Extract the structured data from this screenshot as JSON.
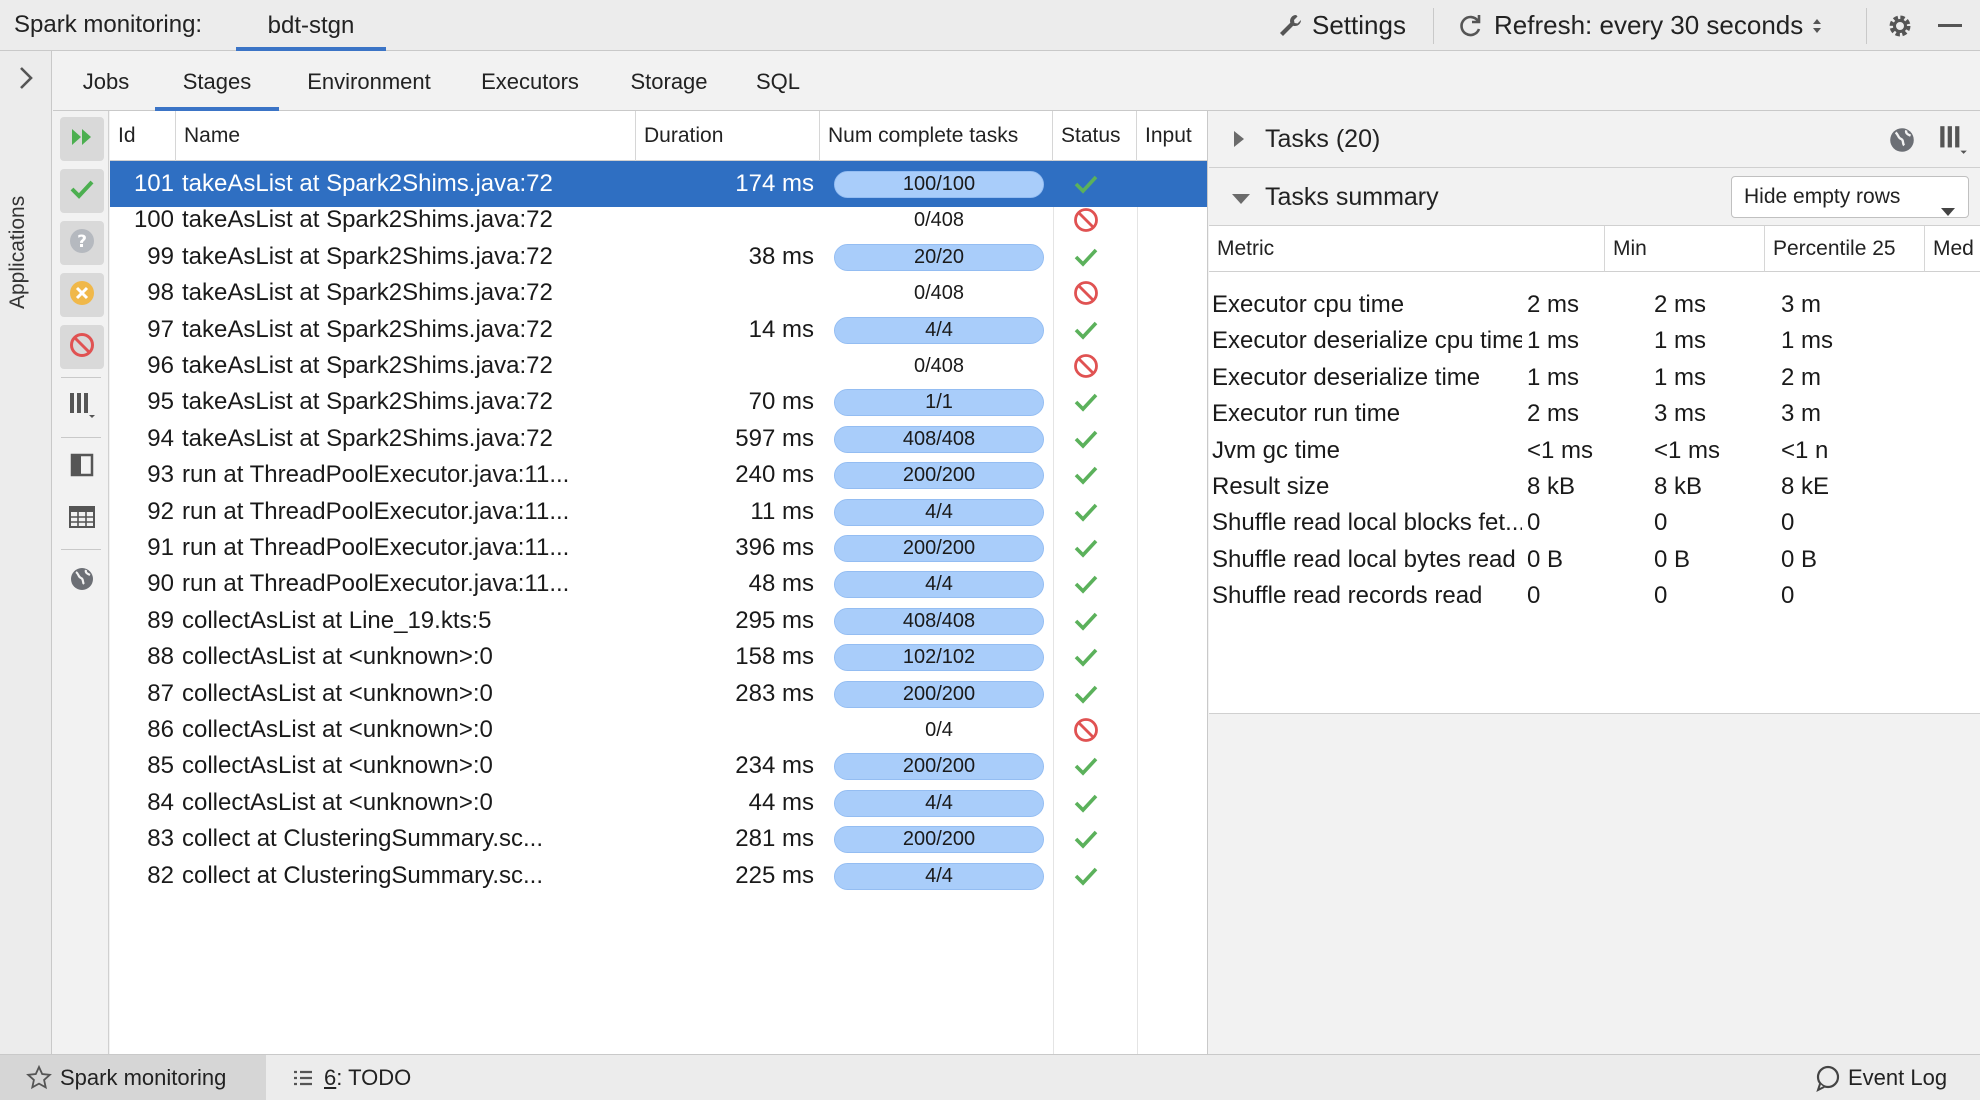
{
  "topbar": {
    "label": "Spark monitoring:",
    "project_tab": "bdt-stgn",
    "settings": "Settings",
    "refresh": "Refresh: every 30 seconds"
  },
  "left_strip": {
    "label": "Applications"
  },
  "tabs": [
    {
      "label": "Jobs"
    },
    {
      "label": "Stages",
      "active": true
    },
    {
      "label": "Environment"
    },
    {
      "label": "Executors"
    },
    {
      "label": "Storage"
    },
    {
      "label": "SQL"
    }
  ],
  "stages": {
    "columns": [
      "Id",
      "Name",
      "Duration",
      "Num complete tasks",
      "Status",
      "Input"
    ],
    "rows": [
      {
        "id": "101",
        "name": "takeAsList at Spark2Shims.java:72",
        "duration": "174 ms",
        "tasks": "100/100",
        "progress": 1,
        "status": "succeeded",
        "selected": true
      },
      {
        "id": "100",
        "name": "takeAsList at Spark2Shims.java:72",
        "duration": "",
        "tasks": "0/408",
        "progress": 0,
        "status": "failed"
      },
      {
        "id": "99",
        "name": "takeAsList at Spark2Shims.java:72",
        "duration": "38 ms",
        "tasks": "20/20",
        "progress": 1,
        "status": "succeeded"
      },
      {
        "id": "98",
        "name": "takeAsList at Spark2Shims.java:72",
        "duration": "",
        "tasks": "0/408",
        "progress": 0,
        "status": "failed"
      },
      {
        "id": "97",
        "name": "takeAsList at Spark2Shims.java:72",
        "duration": "14 ms",
        "tasks": "4/4",
        "progress": 1,
        "status": "succeeded"
      },
      {
        "id": "96",
        "name": "takeAsList at Spark2Shims.java:72",
        "duration": "",
        "tasks": "0/408",
        "progress": 0,
        "status": "failed"
      },
      {
        "id": "95",
        "name": "takeAsList at Spark2Shims.java:72",
        "duration": "70 ms",
        "tasks": "1/1",
        "progress": 1,
        "status": "succeeded"
      },
      {
        "id": "94",
        "name": "takeAsList at Spark2Shims.java:72",
        "duration": "597 ms",
        "tasks": "408/408",
        "progress": 1,
        "status": "succeeded"
      },
      {
        "id": "93",
        "name": "run at ThreadPoolExecutor.java:11...",
        "duration": "240 ms",
        "tasks": "200/200",
        "progress": 1,
        "status": "succeeded"
      },
      {
        "id": "92",
        "name": "run at ThreadPoolExecutor.java:11...",
        "duration": "11 ms",
        "tasks": "4/4",
        "progress": 1,
        "status": "succeeded"
      },
      {
        "id": "91",
        "name": "run at ThreadPoolExecutor.java:11...",
        "duration": "396 ms",
        "tasks": "200/200",
        "progress": 1,
        "status": "succeeded"
      },
      {
        "id": "90",
        "name": "run at ThreadPoolExecutor.java:11...",
        "duration": "48 ms",
        "tasks": "4/4",
        "progress": 1,
        "status": "succeeded"
      },
      {
        "id": "89",
        "name": "collectAsList at Line_19.kts:5",
        "duration": "295 ms",
        "tasks": "408/408",
        "progress": 1,
        "status": "succeeded"
      },
      {
        "id": "88",
        "name": "collectAsList at <unknown>:0",
        "duration": "158 ms",
        "tasks": "102/102",
        "progress": 1,
        "status": "succeeded"
      },
      {
        "id": "87",
        "name": "collectAsList at <unknown>:0",
        "duration": "283 ms",
        "tasks": "200/200",
        "progress": 1,
        "status": "succeeded"
      },
      {
        "id": "86",
        "name": "collectAsList at <unknown>:0",
        "duration": "",
        "tasks": "0/4",
        "progress": 0,
        "status": "failed"
      },
      {
        "id": "85",
        "name": "collectAsList at <unknown>:0",
        "duration": "234 ms",
        "tasks": "200/200",
        "progress": 1,
        "status": "succeeded"
      },
      {
        "id": "84",
        "name": "collectAsList at <unknown>:0",
        "duration": "44 ms",
        "tasks": "4/4",
        "progress": 1,
        "status": "succeeded"
      },
      {
        "id": "83",
        "name": "collect at ClusteringSummary.sc...",
        "duration": "281 ms",
        "tasks": "200/200",
        "progress": 1,
        "status": "succeeded"
      },
      {
        "id": "82",
        "name": "collect at ClusteringSummary.sc...",
        "duration": "225 ms",
        "tasks": "4/4",
        "progress": 1,
        "status": "succeeded"
      }
    ]
  },
  "right_panel": {
    "tasks_title": "Tasks (20)",
    "summary_title": "Tasks summary",
    "filter_value": "Hide empty rows",
    "metric_columns": [
      "Metric",
      "Min",
      "Percentile 25",
      "Med"
    ],
    "metrics": [
      [
        "Executor cpu time",
        "2 ms",
        "2 ms",
        "3 m"
      ],
      [
        "Executor deserialize cpu time",
        "1 ms",
        "1 ms",
        "1 ms"
      ],
      [
        "Executor deserialize time",
        "1 ms",
        "1 ms",
        "2 m"
      ],
      [
        "Executor run time",
        "2 ms",
        "3 ms",
        "3 m"
      ],
      [
        "Jvm gc time",
        "<1 ms",
        "<1 ms",
        "<1 n"
      ],
      [
        "Result size",
        "8 kB",
        "8 kB",
        "8 kE"
      ],
      [
        "Shuffle read local blocks fet...",
        "0",
        "0",
        "0"
      ],
      [
        "Shuffle read local bytes read",
        "0 B",
        "0 B",
        "0 B"
      ],
      [
        "Shuffle read records read",
        "0",
        "0",
        "0"
      ]
    ]
  },
  "bottombar": {
    "spark_monitoring": "Spark monitoring",
    "todo_number": "6",
    "todo_label": ": TODO",
    "event_log": "Event Log"
  },
  "colors": {
    "accent": "#3b74c6",
    "selection": "#2f6fc2",
    "progress": "#a9cdfa",
    "success": "#5bb15b",
    "failed": "#e05252"
  }
}
